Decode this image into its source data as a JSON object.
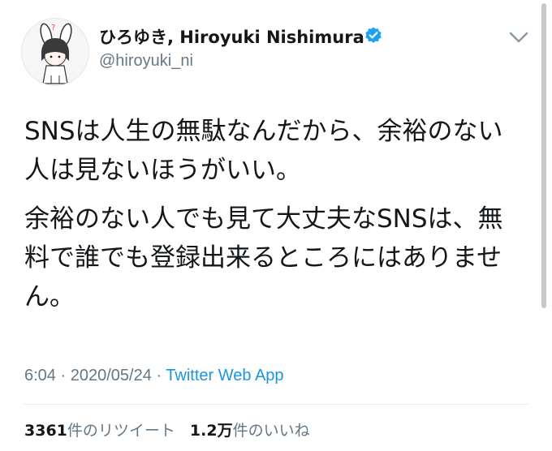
{
  "tweet": {
    "author": {
      "display_name": "ひろゆき, Hiroyuki Nishimura",
      "handle": "@hiroyuki_ni",
      "verified": true
    },
    "paragraphs": [
      "SNSは人生の無駄なんだから、余裕のない人は見ないほうがいい。",
      "余裕のない人でも見て大丈夫なSNSは、無料で誰でも登録出来るところにはありません。"
    ],
    "time": "6:04",
    "separator": "·",
    "date": "2020/05/24",
    "source": "Twitter Web App",
    "retweets": {
      "count": "3361",
      "label": "件のリツイート"
    },
    "likes": {
      "count": "1.2万",
      "label": "件のいいね"
    }
  },
  "colors": {
    "text": "#14171a",
    "muted": "#657786",
    "link": "#1b95e0",
    "verified_badge": "#1da1f2",
    "divider": "#e6ecf0"
  },
  "icons": {
    "verified": "verified-badge-icon",
    "menu": "chevron-down-icon"
  }
}
